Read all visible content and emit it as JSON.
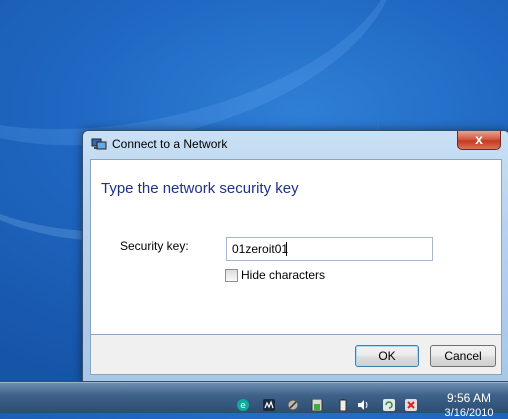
{
  "dialog": {
    "title": "Connect to a Network",
    "close_label": "x",
    "heading": "Type the network security key",
    "security_key_label": "Security key:",
    "security_key_value": "01zeroit01",
    "hide_characters_label": "Hide characters",
    "hide_characters_checked": false,
    "ok_label": "OK",
    "cancel_label": "Cancel"
  },
  "taskbar": {
    "time": "9:56 AM",
    "date": "3/16/2010",
    "tray_icons": [
      "eset-icon",
      "network-monitor-icon",
      "satellite-icon",
      "battery-meter-icon",
      "battery-icon",
      "volume-icon",
      "sync-icon",
      "network-x-icon"
    ]
  },
  "colors": {
    "heading": "#1e3287",
    "taskbar": "#2c4d73",
    "close_button": "#c23b21"
  }
}
